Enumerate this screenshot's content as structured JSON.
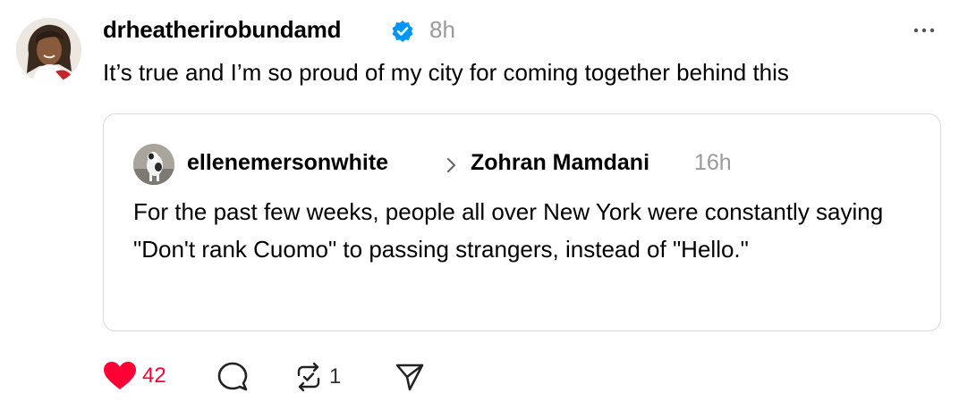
{
  "post": {
    "username": "drheatherirobundamd",
    "time": "8h",
    "text": "It’s true and I’m so proud of my city for coming together behind this"
  },
  "quote": {
    "username": "ellenemersonwhite",
    "reply_to": "Zohran Mamdani",
    "time": "16h",
    "text": "For the past few weeks, people all over New York were constantly saying \"Don't rank Cuomo\" to passing strangers, instead of \"Hello.\""
  },
  "actions": {
    "likes": "42",
    "reposts": "1"
  },
  "icons": {
    "verified": "verified-badge-icon",
    "more": "more-options-icon",
    "like": "heart-icon",
    "reply": "comment-icon",
    "repost": "repost-icon",
    "share": "share-icon"
  },
  "colors": {
    "verified": "#0095f6",
    "like": "#ff0034",
    "muted": "#9a9a9a",
    "border": "#d9d9d9"
  }
}
